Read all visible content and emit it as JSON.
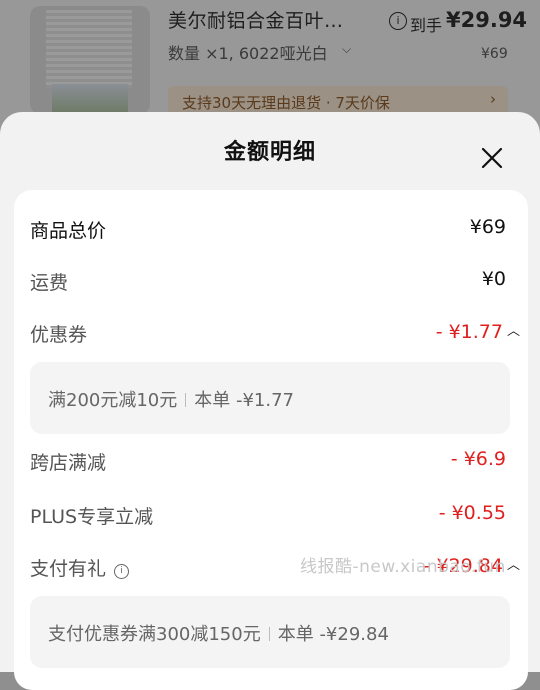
{
  "product": {
    "title": "美尔耐铝合金百叶…",
    "pay_label": "到手",
    "pay_price": "¥29.94",
    "quantity": "数量 ×1, 6022哑光白",
    "original_price": "¥69",
    "promo": "支持30天无理由退货 · 7天价保"
  },
  "sheet": {
    "title": "金额明细"
  },
  "rows": {
    "total": {
      "label": "商品总价",
      "value": "¥69"
    },
    "shipping": {
      "label": "运费",
      "value": "¥0"
    },
    "coupon": {
      "label": "优惠券",
      "value": "- ¥1.77"
    },
    "coupon_detail": {
      "rule": "满200元减10元",
      "applied": "本单 -¥1.77"
    },
    "cross_store": {
      "label": "跨店满减",
      "value": "- ¥6.9"
    },
    "plus": {
      "label": "PLUS专享立减",
      "value": "- ¥0.55"
    },
    "pay_gift": {
      "label": "支付有礼",
      "value": "- ¥29.84"
    },
    "pay_gift_detail": {
      "rule": "支付优惠券满300减150元",
      "applied": "本单 -¥29.84"
    }
  },
  "watermark": "线报酷-new.xianbao.fun",
  "colors": {
    "discount": "#e0201e",
    "sheet_bg": "#f2f2f2",
    "card_bg": "#ffffff"
  }
}
